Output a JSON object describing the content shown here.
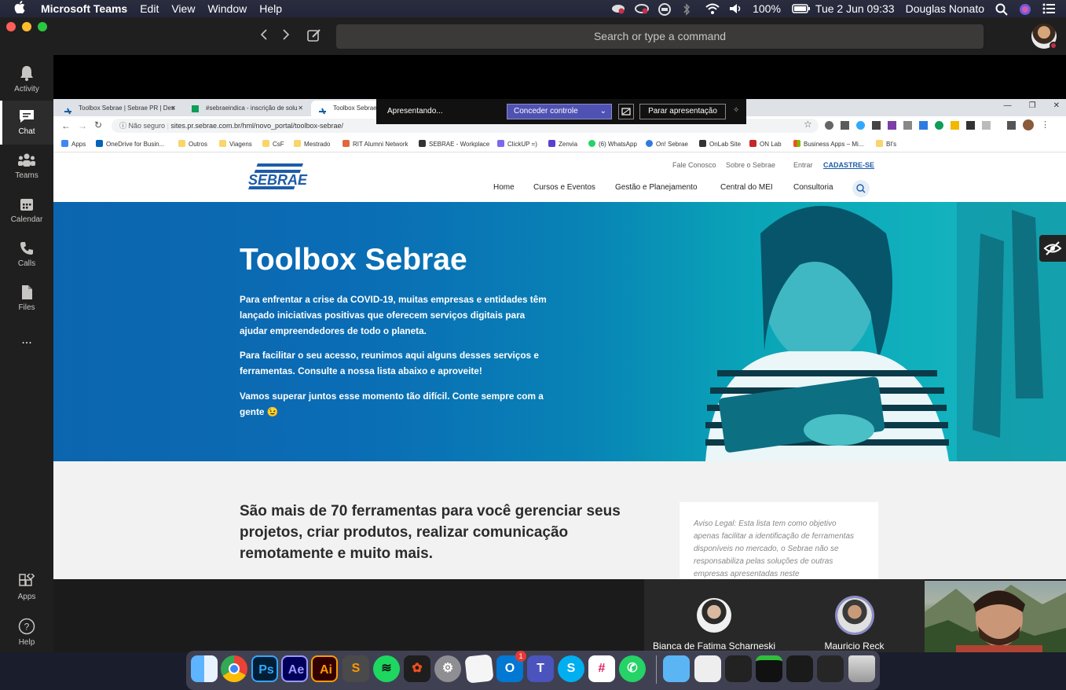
{
  "menubar": {
    "app_name": "Microsoft Teams",
    "items": [
      "Edit",
      "View",
      "Window",
      "Help"
    ],
    "battery": "100%",
    "datetime": "Tue 2 Jun  09:33",
    "user": "Douglas Nonato"
  },
  "teams": {
    "search_placeholder": "Search or type a command",
    "rail": [
      "Activity",
      "Chat",
      "Teams",
      "Calendar",
      "Calls",
      "Files",
      "...",
      "Apps",
      "Help"
    ]
  },
  "browser": {
    "tabs": [
      "Toolbox Sebrae | Sebrae PR | Des",
      "#sebraeindica - inscrição de solu",
      "Toolbox Sebrae"
    ],
    "not_secure": "Não seguro",
    "url": "sites.pr.sebrae.com.br/hml/novo_portal/toolbox-sebrae/",
    "bookmarks": [
      "Apps",
      "OneDrive for Busin...",
      "Outros",
      "Viagens",
      "CsF",
      "Mestrado",
      "RIT Alumni Network",
      "SEBRAE - Workplace",
      "ClickUP =)",
      "Zenvia",
      "(6) WhatsApp",
      "On! Sebrae",
      "OnLab Site",
      "ON Lab",
      "Business Apps – Mi...",
      "BI's"
    ]
  },
  "presenting": {
    "status": "Apresentando...",
    "give_control": "Conceder controle",
    "stop": "Parar apresentação"
  },
  "site": {
    "logo": "SEBRAE",
    "top_links": [
      "Fale Conosco",
      "Sobre o Sebrae",
      "Entrar",
      "CADASTRE-SE"
    ],
    "nav": [
      "Home",
      "Cursos e Eventos",
      "Gestão e Planejamento",
      "Central do MEI",
      "Consultoria"
    ],
    "hero_title": "Toolbox Sebrae",
    "hero_p1": "Para enfrentar a crise da COVID-19, muitas empresas e entidades têm lançado iniciativas positivas que oferecem serviços digitais para ajudar empreendedores de todo o planeta.",
    "hero_p2": "Para facilitar o seu acesso, reunimos aqui alguns desses serviços e ferramentas. Consulte a nossa lista abaixo e aproveite!",
    "hero_p3": "Vamos superar juntos esse momento tão difícil. Conte sempre com a gente 😉",
    "section_title": "São mais de 70 ferramentas para você gerenciar seus projetos, criar produtos, realizar comunicação remotamente e muito mais.",
    "legal": "Aviso Legal: Esta lista tem como objetivo apenas facilitar a identificação de ferramentas disponíveis no mercado, o Sebrae não se responsabiliza pelas soluções de outras empresas apresentadas neste"
  },
  "participants": [
    "Bianca de Fatima Scharneski",
    "Mauricio Reck"
  ],
  "dock": {
    "apps": [
      "Finder",
      "Chrome",
      "Photoshop",
      "After Effects",
      "Illustrator",
      "Sublime Text",
      "Spotify",
      "Figma",
      "System Preferences",
      "TextEdit",
      "Outlook",
      "Teams",
      "Skype",
      "Slack",
      "WhatsApp",
      "Applications",
      "Preview",
      "Terminal",
      "Window",
      "Window",
      "Window",
      "Trash"
    ],
    "outlook_badge": "1"
  },
  "colors": {
    "teams_purple": "#4f52b2",
    "sebrae_blue": "#0d5fa9",
    "hero_teal": "#17b9c1"
  }
}
